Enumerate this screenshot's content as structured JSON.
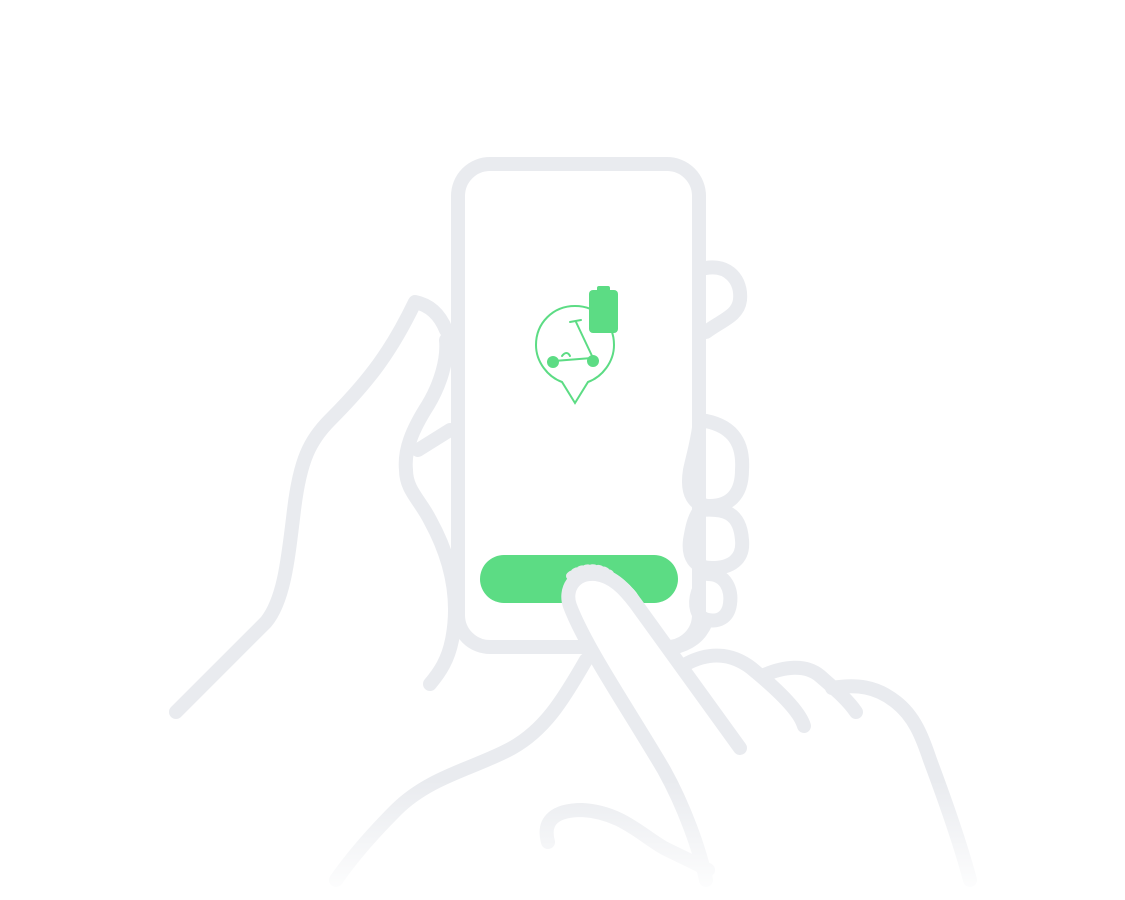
{
  "illustration": {
    "subject": "hands-holding-phone-tapping-button",
    "line_color": "#E9EBEF",
    "accent_color": "#5CDC84",
    "background": "#FFFFFF"
  },
  "phone_screen": {
    "icon": "scooter-location-pin-icon",
    "badge_icon": "battery-full-icon",
    "button_label": ""
  }
}
